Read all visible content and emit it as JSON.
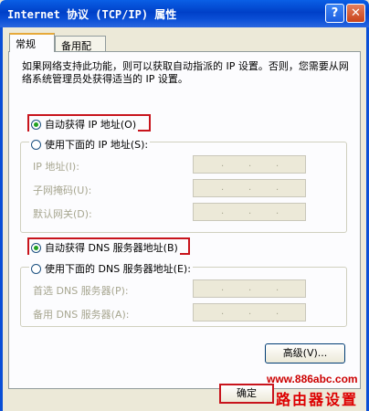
{
  "window": {
    "title": "Internet 协议 (TCP/IP) 属性",
    "help_label": "?",
    "close_label": "✕",
    "help_icon": "help-icon",
    "close_icon": "close-icon"
  },
  "tabs": [
    {
      "label": "常规",
      "active": true
    },
    {
      "label": "备用配置",
      "active": false
    }
  ],
  "description": "如果网络支持此功能，则可以获取自动指派的 IP 设置。否则，您需要从网络系统管理员处获得适当的 IP 设置。",
  "ip": {
    "auto_label": "自动获得 IP 地址(O)",
    "auto_selected": true,
    "manual_label": "使用下面的 IP 地址(S):",
    "manual_selected": false,
    "fields": [
      {
        "label": "IP 地址(I):",
        "value": ""
      },
      {
        "label": "子网掩码(U):",
        "value": ""
      },
      {
        "label": "默认网关(D):",
        "value": ""
      }
    ]
  },
  "dns": {
    "auto_label": "自动获得 DNS 服务器地址(B)",
    "auto_selected": true,
    "manual_label": "使用下面的 DNS 服务器地址(E):",
    "manual_selected": false,
    "fields": [
      {
        "label": "首选 DNS 服务器(P):",
        "value": ""
      },
      {
        "label": "备用 DNS 服务器(A):",
        "value": ""
      }
    ]
  },
  "buttons": {
    "advanced": "高级(V)...",
    "ok": "确定"
  },
  "watermark": {
    "url": "www.886abc.com",
    "text": "路由器设置"
  },
  "colors": {
    "highlight": "#c8141c",
    "titlebar": "#0a4fd6",
    "radio_selected": "#21a121"
  }
}
